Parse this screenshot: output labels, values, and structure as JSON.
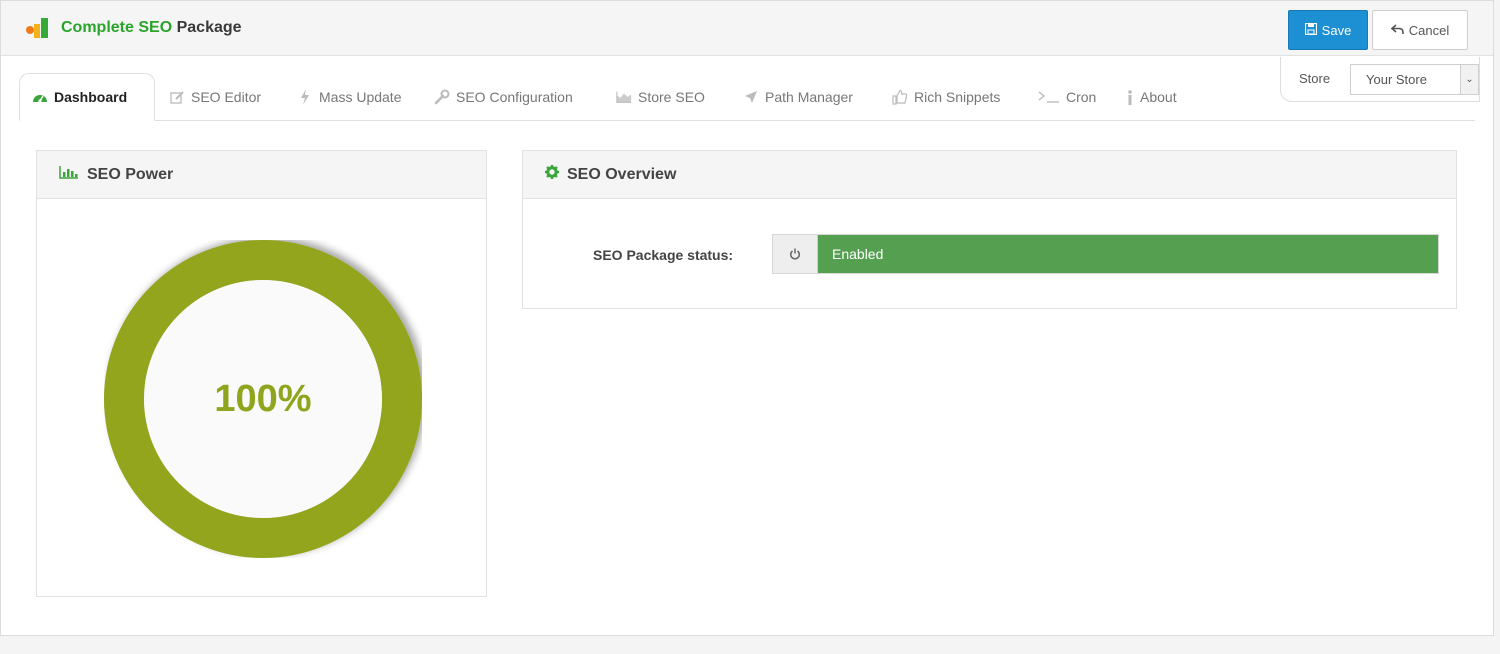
{
  "header": {
    "title_part1": "Complete SEO",
    "title_part2": "Package",
    "save_label": "Save",
    "cancel_label": "Cancel"
  },
  "store": {
    "label": "Store",
    "selected": "Your Store"
  },
  "tabs": [
    {
      "label": "Dashboard",
      "icon": "dashboard-icon",
      "active": true
    },
    {
      "label": "SEO Editor",
      "icon": "edit-icon"
    },
    {
      "label": "Mass Update",
      "icon": "bolt-icon"
    },
    {
      "label": "SEO Configuration",
      "icon": "wrench-icon"
    },
    {
      "label": "Store SEO",
      "icon": "area-chart-icon"
    },
    {
      "label": "Path Manager",
      "icon": "location-arrow-icon"
    },
    {
      "label": "Rich Snippets",
      "icon": "thumbs-up-icon"
    },
    {
      "label": "Cron",
      "icon": "terminal-icon"
    },
    {
      "label": "About",
      "icon": "info-icon"
    }
  ],
  "seo_power": {
    "title": "SEO Power",
    "percent": 100,
    "value_label": "100%"
  },
  "seo_overview": {
    "title": "SEO Overview",
    "status_label": "SEO Package status:",
    "status_value": "Enabled"
  },
  "colors": {
    "brand_green": "#2aa42a",
    "save_blue": "#1d8fd3",
    "donut_olive": "#8fa51d",
    "status_green": "#55a050"
  }
}
